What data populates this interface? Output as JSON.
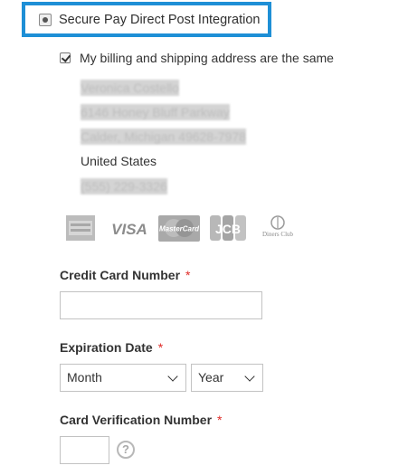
{
  "payment_method": {
    "label": "Secure Pay Direct Post Integration",
    "selected": true,
    "highlight_color": "#1e8fd6"
  },
  "billing": {
    "same_as_shipping_label": "My billing and shipping address are the same",
    "checked": true,
    "address": {
      "name": "Veronica Costello",
      "street": "6146 Honey Bluff Parkway",
      "city_line": "Calder, Michigan 49628-7978",
      "country": "United States",
      "phone": "(555) 229-3326"
    }
  },
  "card_types": [
    {
      "name": "American Express",
      "icon": "amex-icon"
    },
    {
      "name": "Visa",
      "icon": "visa-icon",
      "text": "VISA"
    },
    {
      "name": "MasterCard",
      "icon": "mastercard-icon",
      "text": "MasterCard"
    },
    {
      "name": "JCB",
      "icon": "jcb-icon",
      "text": "JCB"
    },
    {
      "name": "Diners Club",
      "icon": "diners-club-icon",
      "text": "Diners Club"
    }
  ],
  "form": {
    "card_number_label": "Credit Card Number",
    "required_marker": "*",
    "expiration_label": "Expiration Date",
    "month_value": "Month",
    "year_value": "Year",
    "cvv_label": "Card Verification Number",
    "help_glyph": "?"
  },
  "colors": {
    "required": "#e02b27",
    "text": "#333333",
    "input_border": "#c2c2c2"
  }
}
